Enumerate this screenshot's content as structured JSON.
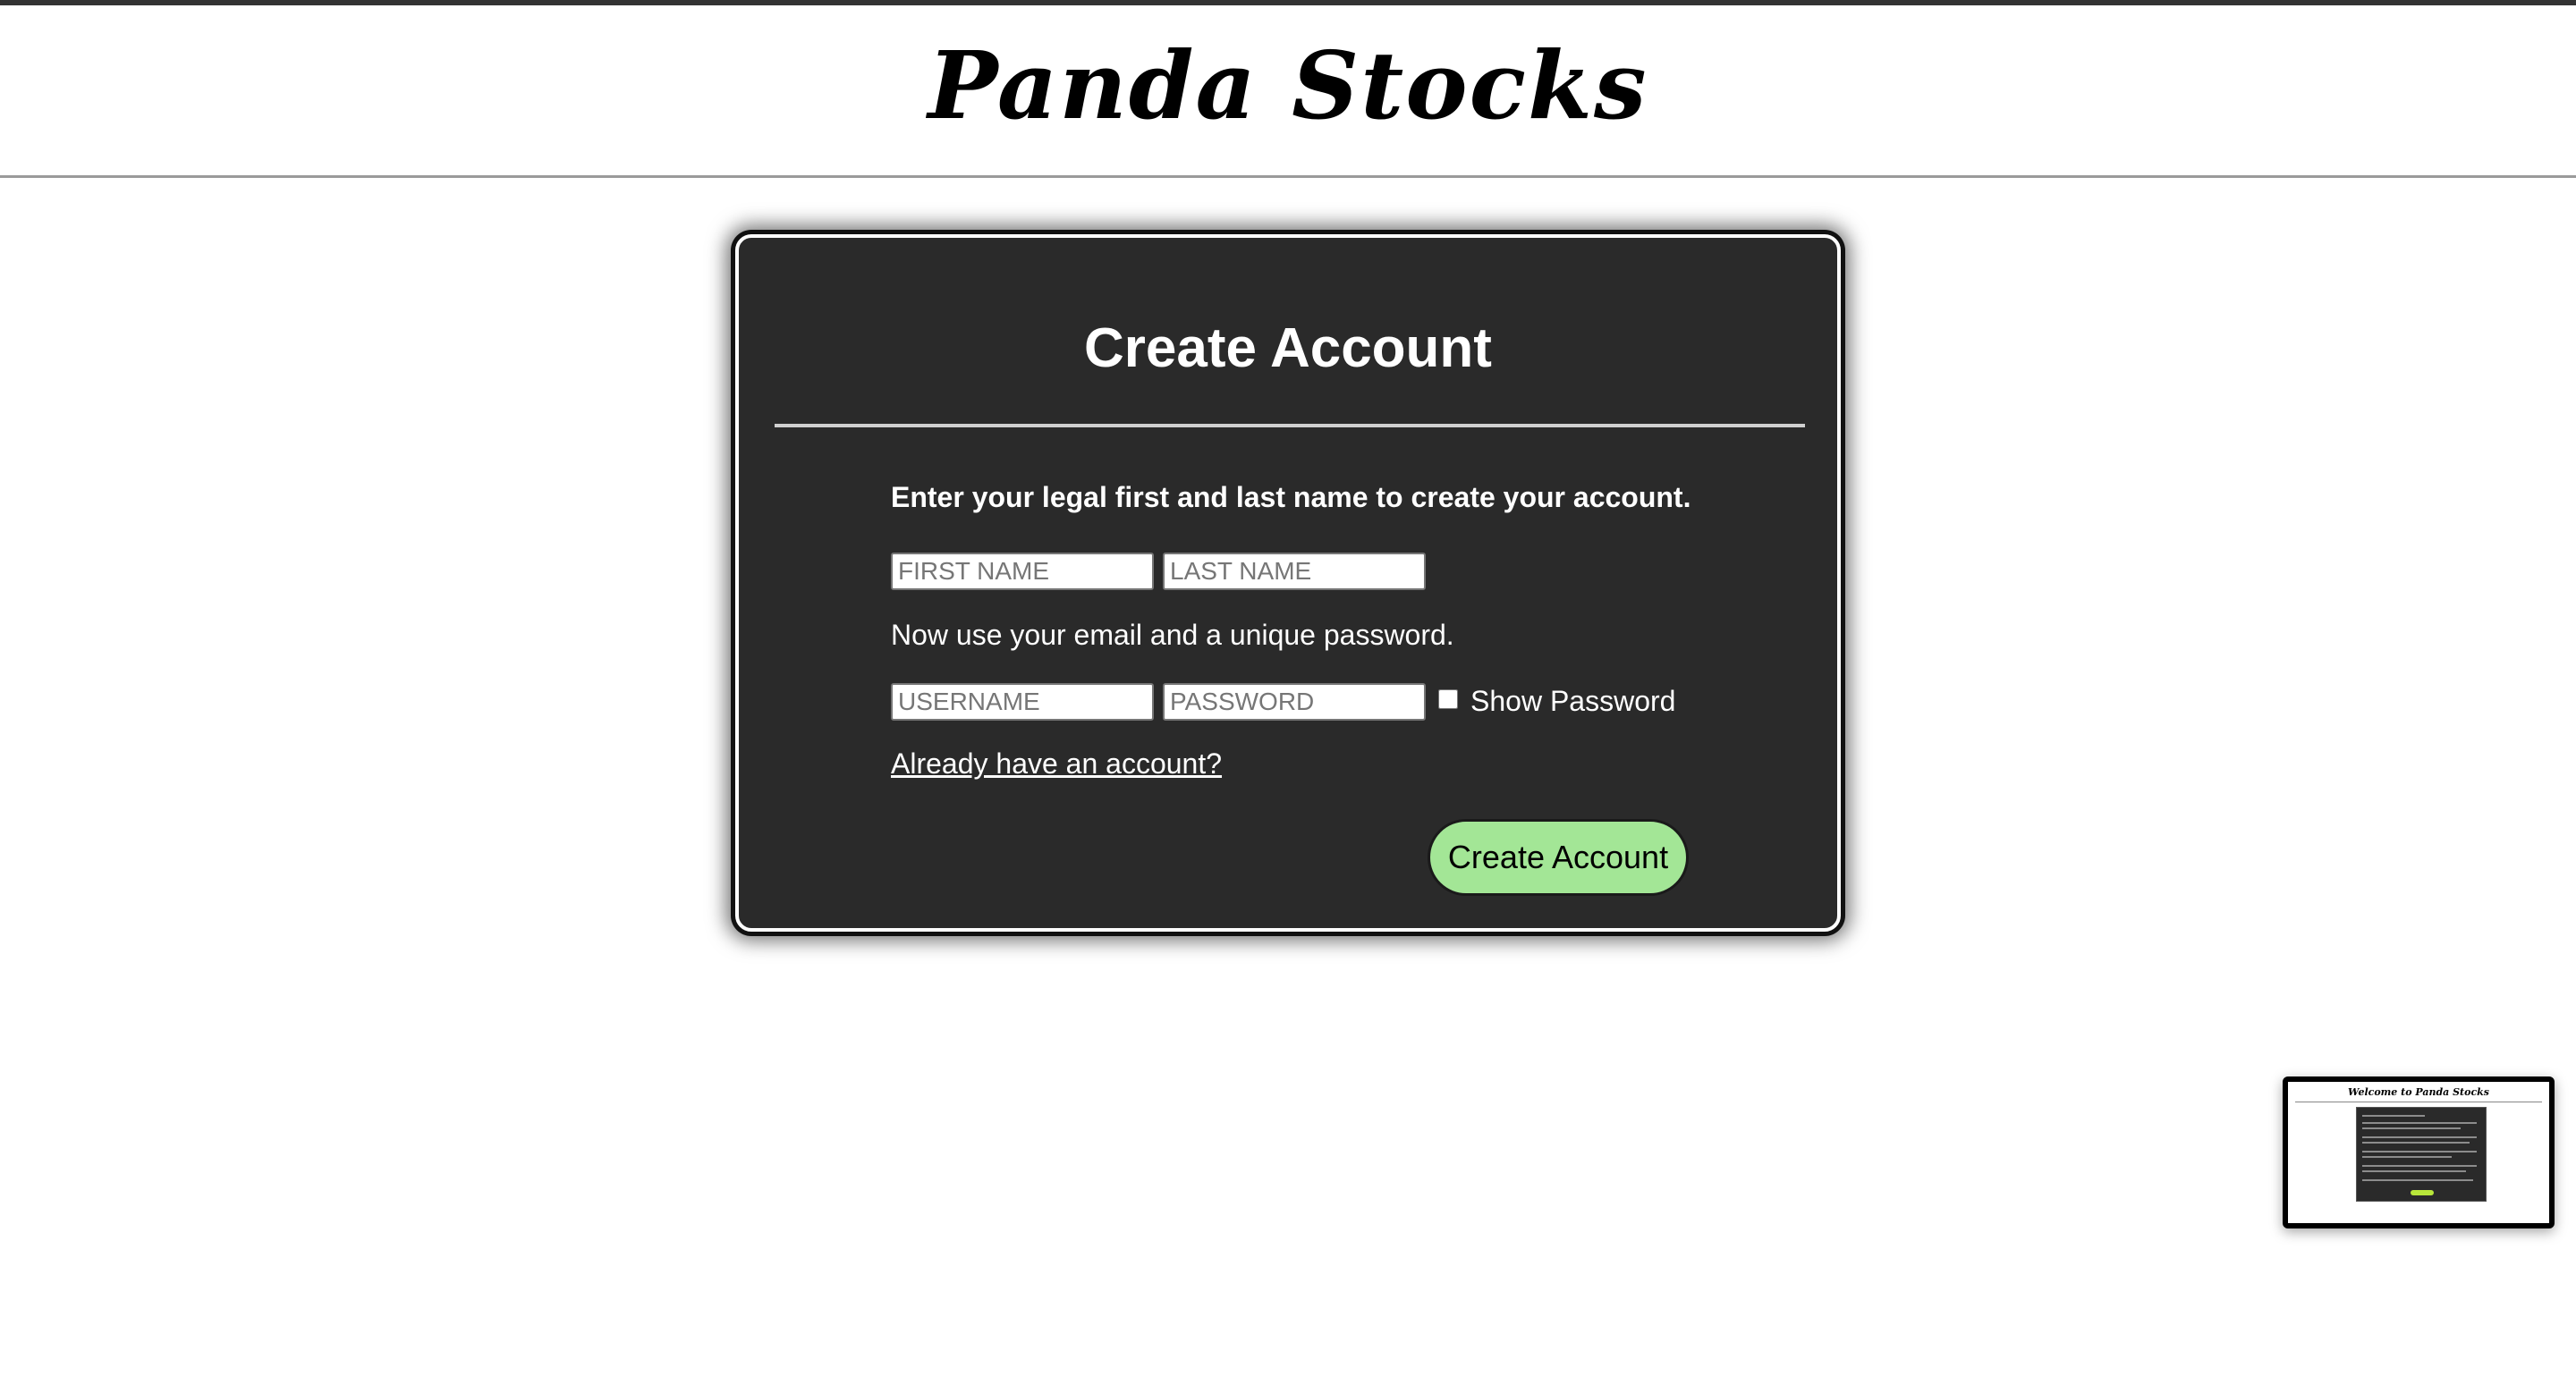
{
  "header": {
    "title": "Panda Stocks"
  },
  "card": {
    "title": "Create Account",
    "instruction_name": "Enter your legal first and last name to create your account.",
    "instruction_credentials": "Now use your email and a unique password.",
    "first_name_placeholder": "FIRST NAME",
    "last_name_placeholder": "LAST NAME",
    "username_placeholder": "USERNAME",
    "password_placeholder": "PASSWORD",
    "show_password_label": "Show Password",
    "show_password_checked": false,
    "login_link": "Already have an account?",
    "submit_label": "Create Account"
  },
  "preview": {
    "title": "Welcome to Panda Stocks"
  },
  "colors": {
    "page_background": "#ffffff",
    "card_background": "#2a2a2a",
    "button_green": "#a3e696",
    "text_light": "#ffffff"
  }
}
